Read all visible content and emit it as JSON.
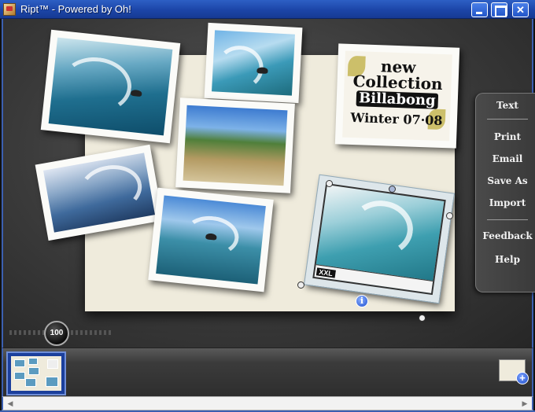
{
  "window": {
    "title": "Ript™ - Powered by Oh!",
    "controls": {
      "minimize": "",
      "maximize": "",
      "close": "✕"
    }
  },
  "canvas": {
    "billboard_card": {
      "line1": "new Collection",
      "logo": "Billabong",
      "line2": "Winter 07·08"
    },
    "selected_photo_banner": "XXL",
    "info_badge": "i"
  },
  "side_menu": {
    "items": [
      {
        "label": "Text"
      },
      {
        "label": "Print"
      },
      {
        "label": "Email"
      },
      {
        "label": "Save As"
      },
      {
        "label": "Import"
      },
      {
        "label": "Feedback"
      },
      {
        "label": "Help"
      }
    ]
  },
  "zoom": {
    "value": "100"
  },
  "filmstrip": {
    "add_page_symbol": "+"
  },
  "colors": {
    "titlebar": "#1c45a8",
    "board": "#efebdc",
    "menu_bg": "#3f3f3f"
  }
}
